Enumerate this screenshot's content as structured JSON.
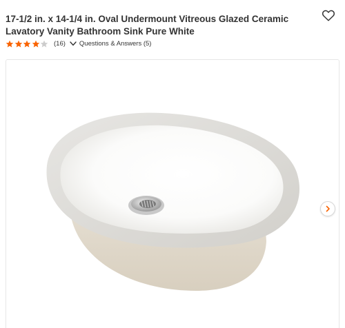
{
  "product": {
    "title": "17-1/2 in. x 14-1/4 in. Oval Undermount Vitreous Glazed Ceramic Lavatory Vanity Bathroom Sink Pure White"
  },
  "rating": {
    "stars": 4.0,
    "max_stars": 5,
    "review_count_text": "(16)",
    "star_color": "#f96302",
    "empty_star_color": "#cccccc"
  },
  "qa": {
    "label": "Questions & Answers (5)"
  },
  "icons": {
    "favorite": "heart-outline-icon",
    "qa_toggle": "chevron-down-icon",
    "gallery_next": "chevron-right-icon"
  },
  "colors": {
    "accent": "#f96302",
    "text": "#333333"
  }
}
